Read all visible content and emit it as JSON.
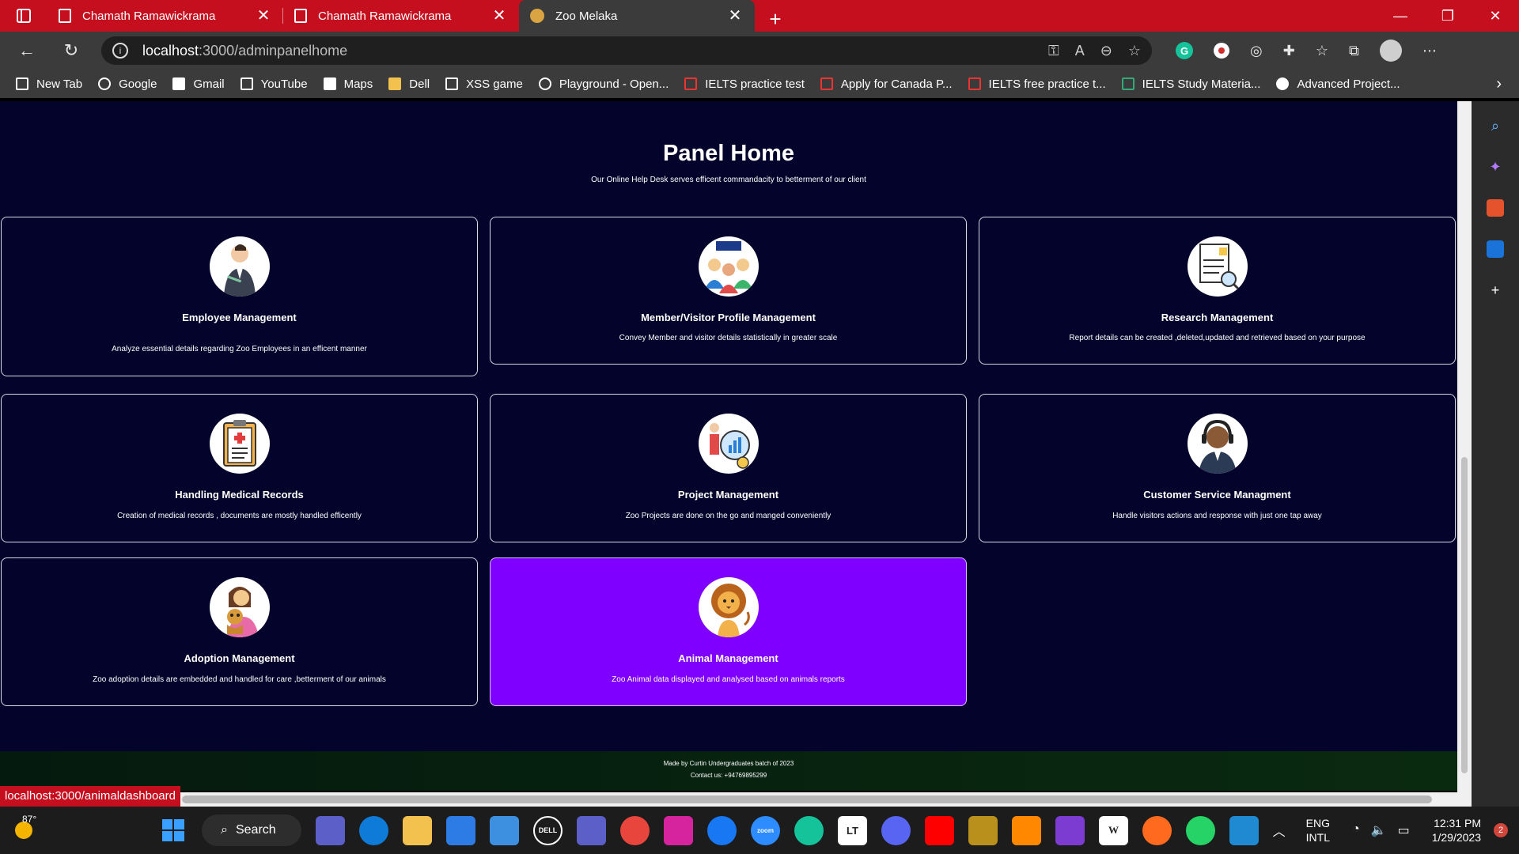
{
  "browser": {
    "tabs": [
      {
        "title": "Chamath Ramawickrama"
      },
      {
        "title": "Chamath Ramawickrama"
      },
      {
        "title": "Zoo Melaka"
      }
    ],
    "address": {
      "host": "localhost",
      "path": ":3000/adminpanelhome"
    },
    "bookmarks": [
      {
        "label": "New Tab"
      },
      {
        "label": "Google"
      },
      {
        "label": "Gmail"
      },
      {
        "label": "YouTube"
      },
      {
        "label": "Maps"
      },
      {
        "label": "Dell"
      },
      {
        "label": "XSS game"
      },
      {
        "label": "Playground - Open..."
      },
      {
        "label": "IELTS practice test"
      },
      {
        "label": "Apply for Canada P..."
      },
      {
        "label": "IELTS free practice t..."
      },
      {
        "label": "IELTS Study Materia..."
      },
      {
        "label": "Advanced Project..."
      }
    ],
    "status_url": "localhost:3000/animaldashboard"
  },
  "page": {
    "title": "Panel Home",
    "subtitle": "Our Online Help Desk serves efficent commandacity to betterment of our client",
    "cards": [
      {
        "title": "Employee Management",
        "desc": "Analyze essential details regarding Zoo Employees in an efficent manner",
        "icon": "employee-icon"
      },
      {
        "title": "Member/Visitor Profile Management",
        "desc": "Convey Member and visitor details statistically in greater scale",
        "icon": "members-icon"
      },
      {
        "title": "Research Management",
        "desc": "Report details can be created ,deleted,updated and retrieved based on your purpose",
        "icon": "research-icon"
      },
      {
        "title": "Handling Medical Records",
        "desc": "Creation of medical records , documents are mostly handled efficently",
        "icon": "medical-clipboard-icon"
      },
      {
        "title": "Project Management",
        "desc": "Zoo Projects are done on the go and manged conveniently",
        "icon": "project-icon"
      },
      {
        "title": "Customer Service Managment",
        "desc": "Handle visitors actions and response with just one tap away",
        "icon": "headset-agent-icon"
      },
      {
        "title": "Adoption Management",
        "desc": "Zoo adoption details are embedded and handled for care ,betterment of our animals",
        "icon": "adoption-icon"
      },
      {
        "title": "Animal Management",
        "desc": "Zoo Animal data displayed and analysed based on animals reports",
        "icon": "lion-icon",
        "highlighted": true
      }
    ],
    "footer": {
      "line1": "Made by Curtin Undergraduates batch of 2023",
      "line2": "Contact us: +94769895299"
    }
  },
  "taskbar": {
    "weather_temp": "87°",
    "search_label": "Search",
    "lang_line1": "ENG",
    "lang_line2": "INTL",
    "time": "12:31 PM",
    "date": "1/29/2023",
    "notifications": "2"
  },
  "colors": {
    "page_bg": "#03032b",
    "highlight": "#7f00ff",
    "browser_accent": "#c50f1f"
  }
}
